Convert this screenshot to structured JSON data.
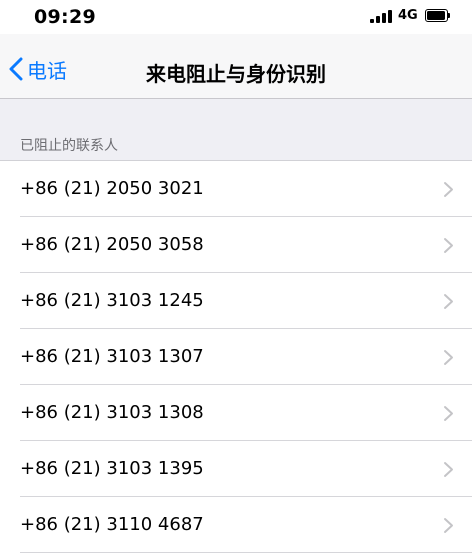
{
  "status_bar": {
    "time": "09:29",
    "network": "4G",
    "battery_level": 0.9
  },
  "nav_bar": {
    "back_label": "电话",
    "title": "来电阻止与身份识别"
  },
  "section": {
    "header": "已阻止的联系人"
  },
  "blocked_contacts": [
    "+86 (21) 2050 3021",
    "+86 (21) 2050 3058",
    "+86 (21) 3103 1245",
    "+86 (21) 3103 1307",
    "+86 (21) 3103 1308",
    "+86 (21) 3103 1395",
    "+86 (21) 3110 4687"
  ],
  "colors": {
    "accent": "#0a7aff",
    "grouped_background": "#efeff4",
    "chevron": "#c4c4c7"
  },
  "icons": {
    "back": "chevron-left-icon",
    "row_disclosure": "chevron-right-icon",
    "signal": "cellular-signal-icon",
    "battery": "battery-icon"
  }
}
